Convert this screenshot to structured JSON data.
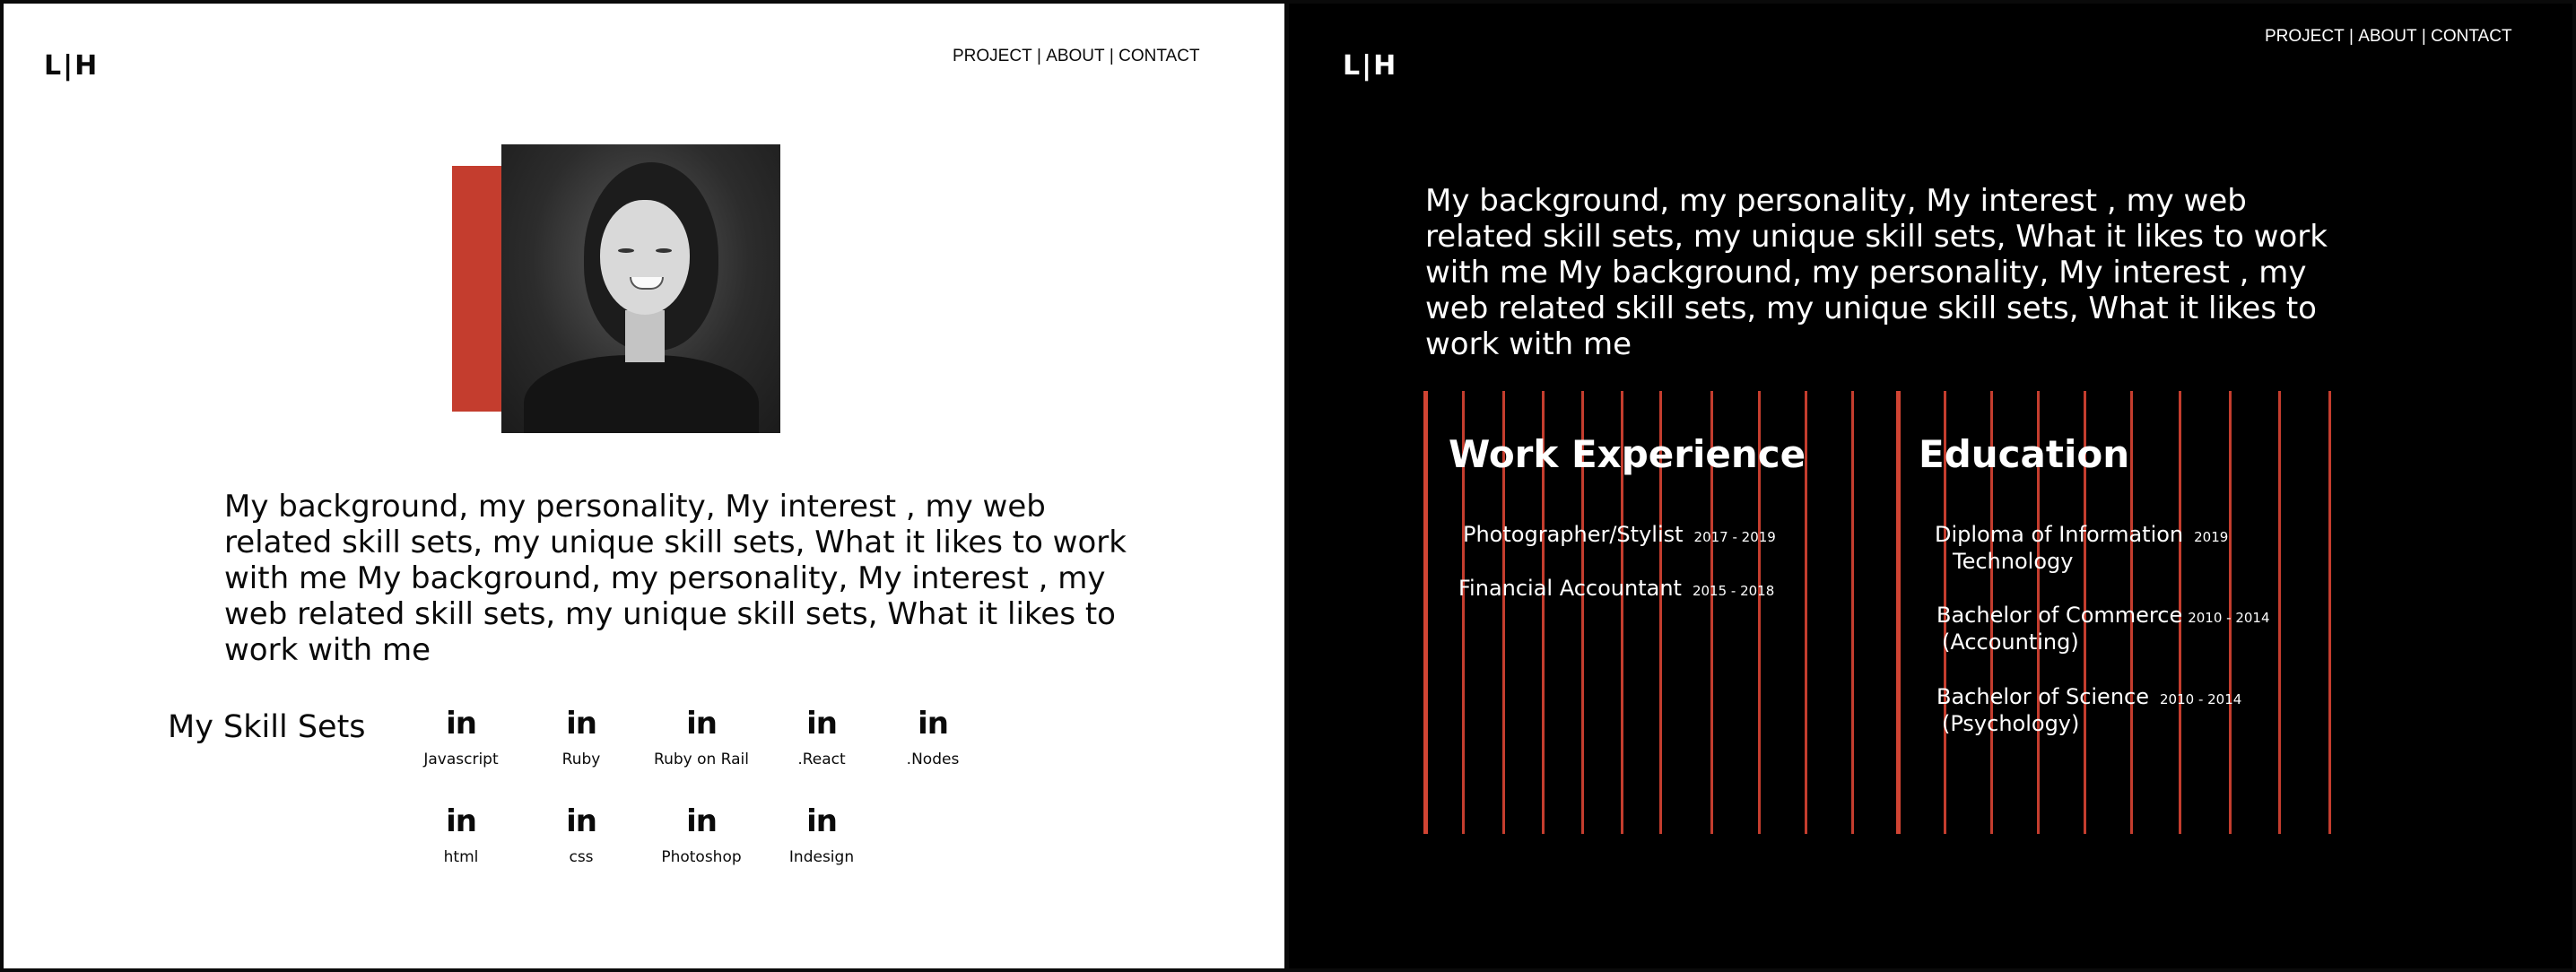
{
  "light": {
    "logo": "L|H",
    "nav": {
      "project": "PROJECT",
      "sep1": " | ",
      "about": "ABOUT",
      "sep2": " | ",
      "contact": "CONTACT"
    },
    "bio": "My background, my personality, My interest , my web related skill sets, my unique skill sets, What it likes to work with me My background, my personality, My interest , my web related skill sets, my unique skill sets, What it likes to work with me",
    "skills_heading": "My Skill Sets",
    "skill_icon": "in",
    "skills": [
      "Javascript",
      "Ruby",
      "Ruby on Rail",
      ".React",
      ".Nodes",
      "html",
      "css",
      "Photoshop",
      "Indesign"
    ]
  },
  "dark": {
    "logo": "L|H",
    "nav": {
      "project": "PROJECT",
      "sep1": " | ",
      "about": "ABOUT",
      "sep2": " | ",
      "contact": "CONTACT"
    },
    "bio": "My background, my personality, My interest , my web related skill sets, my unique skill sets, What it likes to work with me My background, my personality, My interest , my web related skill sets, my unique skill sets, What it likes to work with me",
    "work": {
      "title": "Work Experience",
      "items": [
        {
          "title": "Photographer/Stylist",
          "years": "2017 - 2019"
        },
        {
          "title": "Financial Accountant",
          "years": "2015 - 2018"
        }
      ]
    },
    "education": {
      "title": "Education",
      "items": [
        {
          "title": "Diploma of Information",
          "years": "2019",
          "sub": "Technology"
        },
        {
          "title": "Bachelor of Commerce",
          "years": "2010 - 2014",
          "sub": "(Accounting)"
        },
        {
          "title": "Bachelor of Science",
          "years": "2010 - 2014",
          "sub": "(Psychology)"
        }
      ]
    }
  },
  "colors": {
    "accent": "#c43d2e",
    "light_bg": "#ffffff",
    "dark_bg": "#000000"
  },
  "icons": {
    "skill": "linkedin-in-icon"
  }
}
